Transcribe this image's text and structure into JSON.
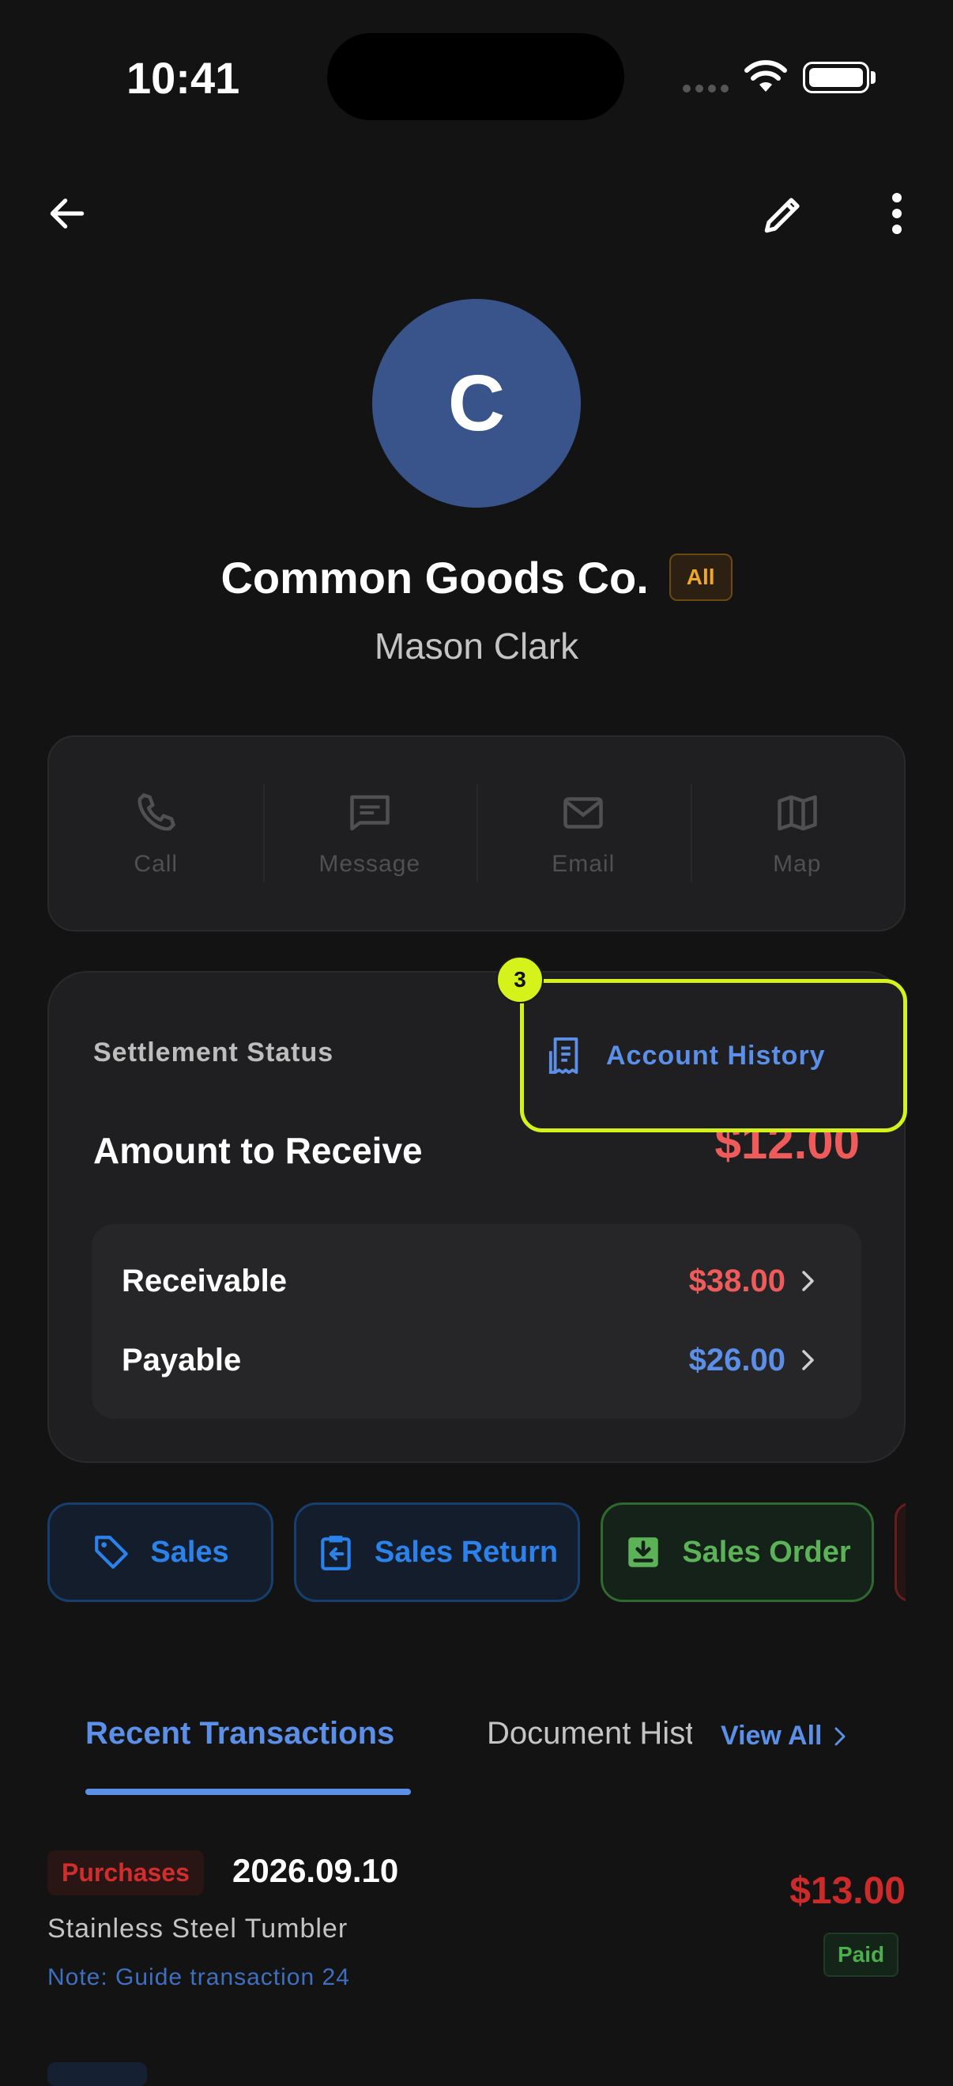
{
  "status_bar": {
    "time": "10:41"
  },
  "header": {
    "back_icon": "arrow-left-icon",
    "edit_icon": "pencil-icon",
    "more_icon": "more-vertical-icon"
  },
  "profile": {
    "avatar_initial": "C",
    "avatar_color": "#38548a",
    "company": "Common Goods Co.",
    "tag": "All",
    "contact": "Mason Clark"
  },
  "actions": [
    {
      "label": "Call",
      "icon": "phone-icon"
    },
    {
      "label": "Message",
      "icon": "message-icon"
    },
    {
      "label": "Email",
      "icon": "mail-icon"
    },
    {
      "label": "Map",
      "icon": "map-icon"
    }
  ],
  "settlement": {
    "label": "Settlement Status",
    "account_history": "Account History",
    "highlight_badge": "3",
    "amount_label": "Amount to Receive",
    "amount_value": "$12.00",
    "receivable": {
      "label": "Receivable",
      "value": "$38.00",
      "color": "#ef5b5b"
    },
    "payable": {
      "label": "Payable",
      "value": "$26.00",
      "color": "#5b8fe8"
    }
  },
  "quick_actions": [
    {
      "label": "Sales",
      "icon": "tag-icon"
    },
    {
      "label": "Sales Return",
      "icon": "return-clipboard-icon"
    },
    {
      "label": "Sales Order",
      "icon": "download-box-icon"
    }
  ],
  "tabs": {
    "recent": "Recent Transactions",
    "document": "Document History",
    "view_all": "View All"
  },
  "transactions": [
    {
      "type": "Purchases",
      "date": "2026.09.10",
      "item": "Stainless Steel Tumbler",
      "note": "Note: Guide transaction 24",
      "amount": "$13.00",
      "status": "Paid"
    }
  ],
  "colors": {
    "accent": "#5b8fe8",
    "highlight": "#d5f21b",
    "negative": "#ef5b5b",
    "background": "#131314"
  }
}
